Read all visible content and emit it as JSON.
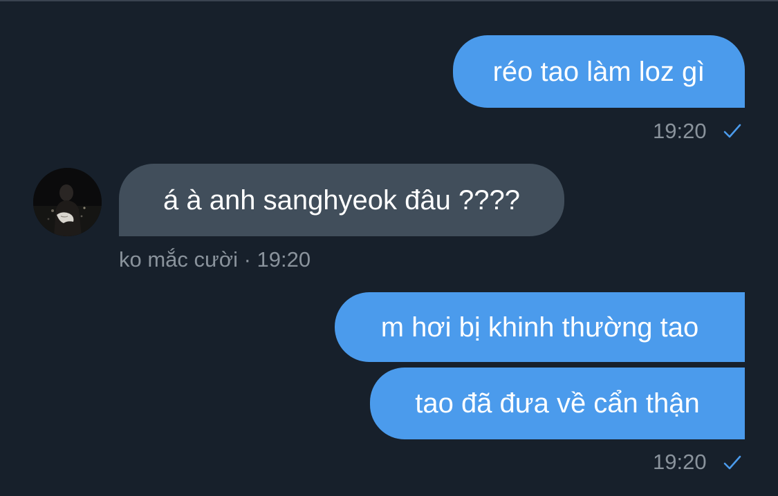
{
  "colors": {
    "background": "#17202b",
    "sent_bubble": "#4b9bec",
    "received_bubble": "#414e5b",
    "meta_text": "#8a939c",
    "check_mark": "#4b9bec"
  },
  "messages": [
    {
      "direction": "sent",
      "text": "réo tao làm loz gì",
      "time": "19:20",
      "status_icon": "check-icon"
    },
    {
      "direction": "received",
      "text": "á à anh sanghyeok đâu ????",
      "meta": "ko mắc cười · 19:20",
      "avatar_icon": "avatar-photo"
    },
    {
      "direction": "sent",
      "text": "m hơi bị khinh thường tao"
    },
    {
      "direction": "sent",
      "text": "tao đã đưa về cẩn thận",
      "time": "19:20",
      "status_icon": "check-icon"
    }
  ]
}
